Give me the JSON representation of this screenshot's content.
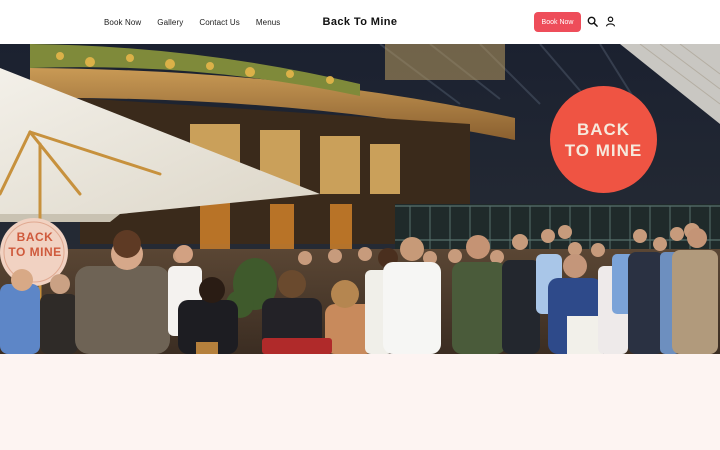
{
  "header": {
    "nav": [
      {
        "label": "Book Now"
      },
      {
        "label": "Gallery"
      },
      {
        "label": "Contact Us"
      },
      {
        "label": "Menus"
      }
    ],
    "logo": "Back To Mine",
    "book_button": "Book Now",
    "icons": [
      "search-icon",
      "user-icon"
    ]
  },
  "hero": {
    "badge_line1": "BACK",
    "badge_line2": "TO MINE",
    "sign_line1": "BACK",
    "sign_line2": "TO MINE"
  },
  "colors": {
    "accent": "#ee4d5a",
    "badge": "#ef5443",
    "page_background": "#fdf4f2"
  }
}
